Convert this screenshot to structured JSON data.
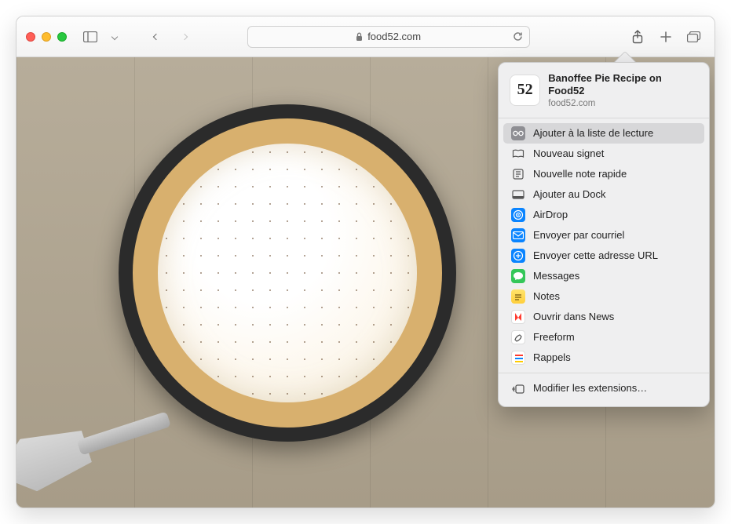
{
  "browser": {
    "domain": "food52.com"
  },
  "share": {
    "thumb_text": "52",
    "title": "Banoffee Pie Recipe on Food52",
    "subtitle": "food52.com",
    "items": [
      {
        "id": "reading-list",
        "label": "Ajouter à la liste de lecture",
        "selected": true,
        "icon": "glasses",
        "kind": "gray"
      },
      {
        "id": "bookmark",
        "label": "Nouveau signet",
        "icon": "book",
        "kind": "outline"
      },
      {
        "id": "quicknote",
        "label": "Nouvelle note rapide",
        "icon": "note",
        "kind": "outline"
      },
      {
        "id": "dock",
        "label": "Ajouter au Dock",
        "icon": "dock",
        "kind": "outline"
      },
      {
        "id": "airdrop",
        "label": "AirDrop",
        "icon": "airdrop",
        "kind": "blue"
      },
      {
        "id": "mail",
        "label": "Envoyer par courriel",
        "icon": "mail",
        "kind": "blue"
      },
      {
        "id": "sendurl",
        "label": "Envoyer cette adresse URL",
        "icon": "sendurl",
        "kind": "blue"
      },
      {
        "id": "messages",
        "label": "Messages",
        "icon": "messages",
        "kind": "green"
      },
      {
        "id": "notes",
        "label": "Notes",
        "icon": "notes",
        "kind": "yellow"
      },
      {
        "id": "news",
        "label": "Ouvrir dans News",
        "icon": "news",
        "kind": "white"
      },
      {
        "id": "freeform",
        "label": "Freeform",
        "icon": "freeform",
        "kind": "white"
      },
      {
        "id": "reminders",
        "label": "Rappels",
        "icon": "reminders",
        "kind": "lines"
      }
    ],
    "footer_label": "Modifier les extensions…"
  }
}
